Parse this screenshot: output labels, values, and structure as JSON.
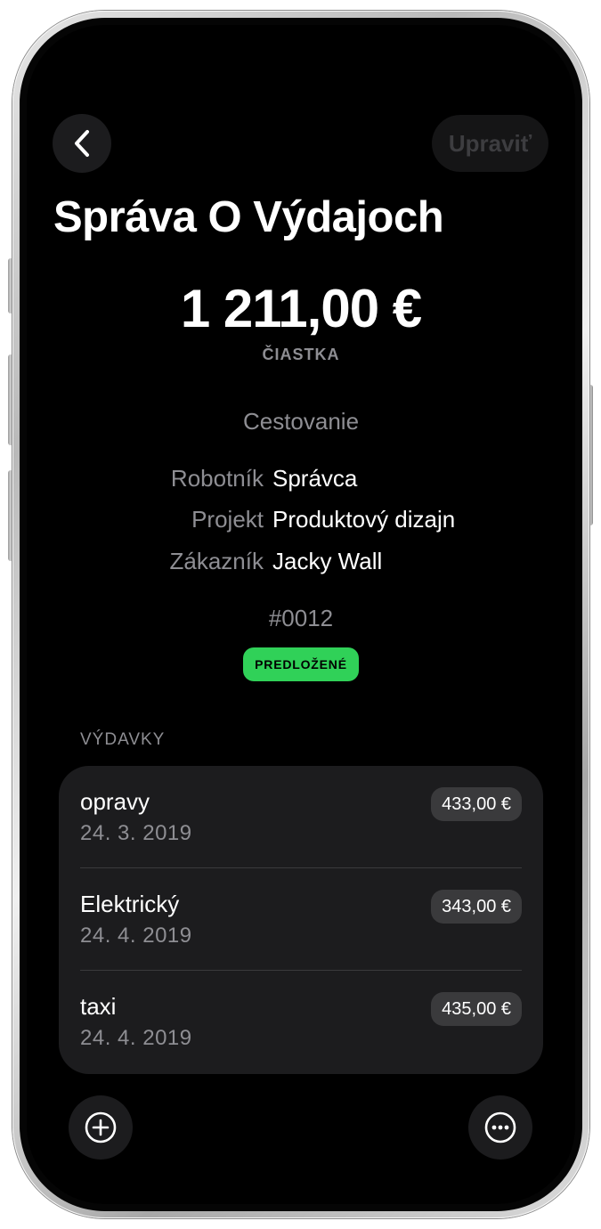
{
  "nav": {
    "back_icon": "chevron-left-icon",
    "edit_label": "Upraviť"
  },
  "report": {
    "title": "Správa O Výdajoch",
    "amount": "1 211,00 €",
    "amount_label": "ČIASTKA",
    "category": "Cestovanie",
    "details": [
      {
        "key": "Robotník",
        "value": "Správca"
      },
      {
        "key": "Projekt",
        "value": "Produktový dizajn"
      },
      {
        "key": "Zákazník",
        "value": "Jacky Wall"
      }
    ],
    "number": "#0012",
    "status": "PREDLOŽENÉ",
    "status_color": "#30d158"
  },
  "expenses": {
    "section_label": "VÝDAVKY",
    "items": [
      {
        "name": "opravy",
        "date": "24. 3. 2019",
        "amount": "433,00 €"
      },
      {
        "name": "Elektrický",
        "date": "24. 4. 2019",
        "amount": "343,00 €"
      },
      {
        "name": "taxi",
        "date": "24. 4. 2019",
        "amount": "435,00 €"
      }
    ]
  },
  "toolbar": {
    "add_icon": "plus-circle-icon",
    "more_icon": "ellipsis-circle-icon"
  },
  "colors": {
    "background": "#000000",
    "card": "#1c1c1e",
    "secondary_text": "#8e8e93",
    "accent_green": "#30d158"
  }
}
